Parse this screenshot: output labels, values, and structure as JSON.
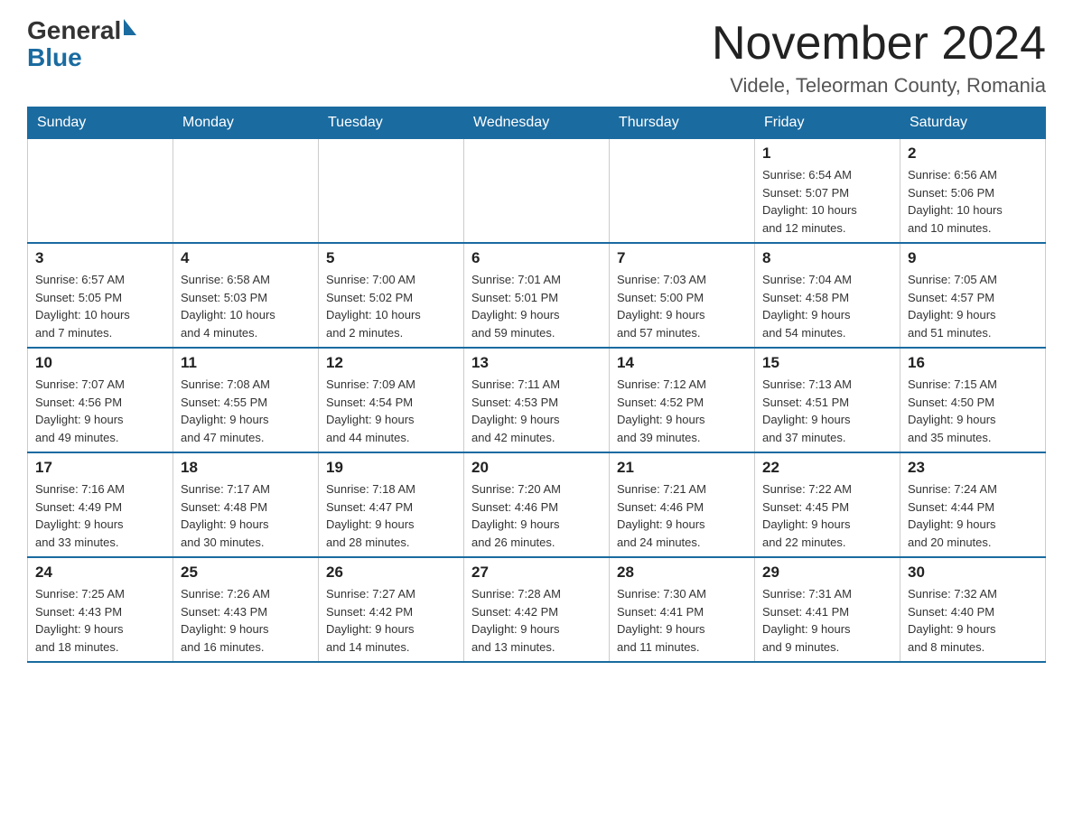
{
  "header": {
    "logo_general": "General",
    "logo_blue": "Blue",
    "month_title": "November 2024",
    "subtitle": "Videle, Teleorman County, Romania"
  },
  "calendar": {
    "days_of_week": [
      "Sunday",
      "Monday",
      "Tuesday",
      "Wednesday",
      "Thursday",
      "Friday",
      "Saturday"
    ],
    "weeks": [
      {
        "days": [
          {
            "number": "",
            "info": ""
          },
          {
            "number": "",
            "info": ""
          },
          {
            "number": "",
            "info": ""
          },
          {
            "number": "",
            "info": ""
          },
          {
            "number": "",
            "info": ""
          },
          {
            "number": "1",
            "info": "Sunrise: 6:54 AM\nSunset: 5:07 PM\nDaylight: 10 hours\nand 12 minutes."
          },
          {
            "number": "2",
            "info": "Sunrise: 6:56 AM\nSunset: 5:06 PM\nDaylight: 10 hours\nand 10 minutes."
          }
        ]
      },
      {
        "days": [
          {
            "number": "3",
            "info": "Sunrise: 6:57 AM\nSunset: 5:05 PM\nDaylight: 10 hours\nand 7 minutes."
          },
          {
            "number": "4",
            "info": "Sunrise: 6:58 AM\nSunset: 5:03 PM\nDaylight: 10 hours\nand 4 minutes."
          },
          {
            "number": "5",
            "info": "Sunrise: 7:00 AM\nSunset: 5:02 PM\nDaylight: 10 hours\nand 2 minutes."
          },
          {
            "number": "6",
            "info": "Sunrise: 7:01 AM\nSunset: 5:01 PM\nDaylight: 9 hours\nand 59 minutes."
          },
          {
            "number": "7",
            "info": "Sunrise: 7:03 AM\nSunset: 5:00 PM\nDaylight: 9 hours\nand 57 minutes."
          },
          {
            "number": "8",
            "info": "Sunrise: 7:04 AM\nSunset: 4:58 PM\nDaylight: 9 hours\nand 54 minutes."
          },
          {
            "number": "9",
            "info": "Sunrise: 7:05 AM\nSunset: 4:57 PM\nDaylight: 9 hours\nand 51 minutes."
          }
        ]
      },
      {
        "days": [
          {
            "number": "10",
            "info": "Sunrise: 7:07 AM\nSunset: 4:56 PM\nDaylight: 9 hours\nand 49 minutes."
          },
          {
            "number": "11",
            "info": "Sunrise: 7:08 AM\nSunset: 4:55 PM\nDaylight: 9 hours\nand 47 minutes."
          },
          {
            "number": "12",
            "info": "Sunrise: 7:09 AM\nSunset: 4:54 PM\nDaylight: 9 hours\nand 44 minutes."
          },
          {
            "number": "13",
            "info": "Sunrise: 7:11 AM\nSunset: 4:53 PM\nDaylight: 9 hours\nand 42 minutes."
          },
          {
            "number": "14",
            "info": "Sunrise: 7:12 AM\nSunset: 4:52 PM\nDaylight: 9 hours\nand 39 minutes."
          },
          {
            "number": "15",
            "info": "Sunrise: 7:13 AM\nSunset: 4:51 PM\nDaylight: 9 hours\nand 37 minutes."
          },
          {
            "number": "16",
            "info": "Sunrise: 7:15 AM\nSunset: 4:50 PM\nDaylight: 9 hours\nand 35 minutes."
          }
        ]
      },
      {
        "days": [
          {
            "number": "17",
            "info": "Sunrise: 7:16 AM\nSunset: 4:49 PM\nDaylight: 9 hours\nand 33 minutes."
          },
          {
            "number": "18",
            "info": "Sunrise: 7:17 AM\nSunset: 4:48 PM\nDaylight: 9 hours\nand 30 minutes."
          },
          {
            "number": "19",
            "info": "Sunrise: 7:18 AM\nSunset: 4:47 PM\nDaylight: 9 hours\nand 28 minutes."
          },
          {
            "number": "20",
            "info": "Sunrise: 7:20 AM\nSunset: 4:46 PM\nDaylight: 9 hours\nand 26 minutes."
          },
          {
            "number": "21",
            "info": "Sunrise: 7:21 AM\nSunset: 4:46 PM\nDaylight: 9 hours\nand 24 minutes."
          },
          {
            "number": "22",
            "info": "Sunrise: 7:22 AM\nSunset: 4:45 PM\nDaylight: 9 hours\nand 22 minutes."
          },
          {
            "number": "23",
            "info": "Sunrise: 7:24 AM\nSunset: 4:44 PM\nDaylight: 9 hours\nand 20 minutes."
          }
        ]
      },
      {
        "days": [
          {
            "number": "24",
            "info": "Sunrise: 7:25 AM\nSunset: 4:43 PM\nDaylight: 9 hours\nand 18 minutes."
          },
          {
            "number": "25",
            "info": "Sunrise: 7:26 AM\nSunset: 4:43 PM\nDaylight: 9 hours\nand 16 minutes."
          },
          {
            "number": "26",
            "info": "Sunrise: 7:27 AM\nSunset: 4:42 PM\nDaylight: 9 hours\nand 14 minutes."
          },
          {
            "number": "27",
            "info": "Sunrise: 7:28 AM\nSunset: 4:42 PM\nDaylight: 9 hours\nand 13 minutes."
          },
          {
            "number": "28",
            "info": "Sunrise: 7:30 AM\nSunset: 4:41 PM\nDaylight: 9 hours\nand 11 minutes."
          },
          {
            "number": "29",
            "info": "Sunrise: 7:31 AM\nSunset: 4:41 PM\nDaylight: 9 hours\nand 9 minutes."
          },
          {
            "number": "30",
            "info": "Sunrise: 7:32 AM\nSunset: 4:40 PM\nDaylight: 9 hours\nand 8 minutes."
          }
        ]
      }
    ]
  }
}
